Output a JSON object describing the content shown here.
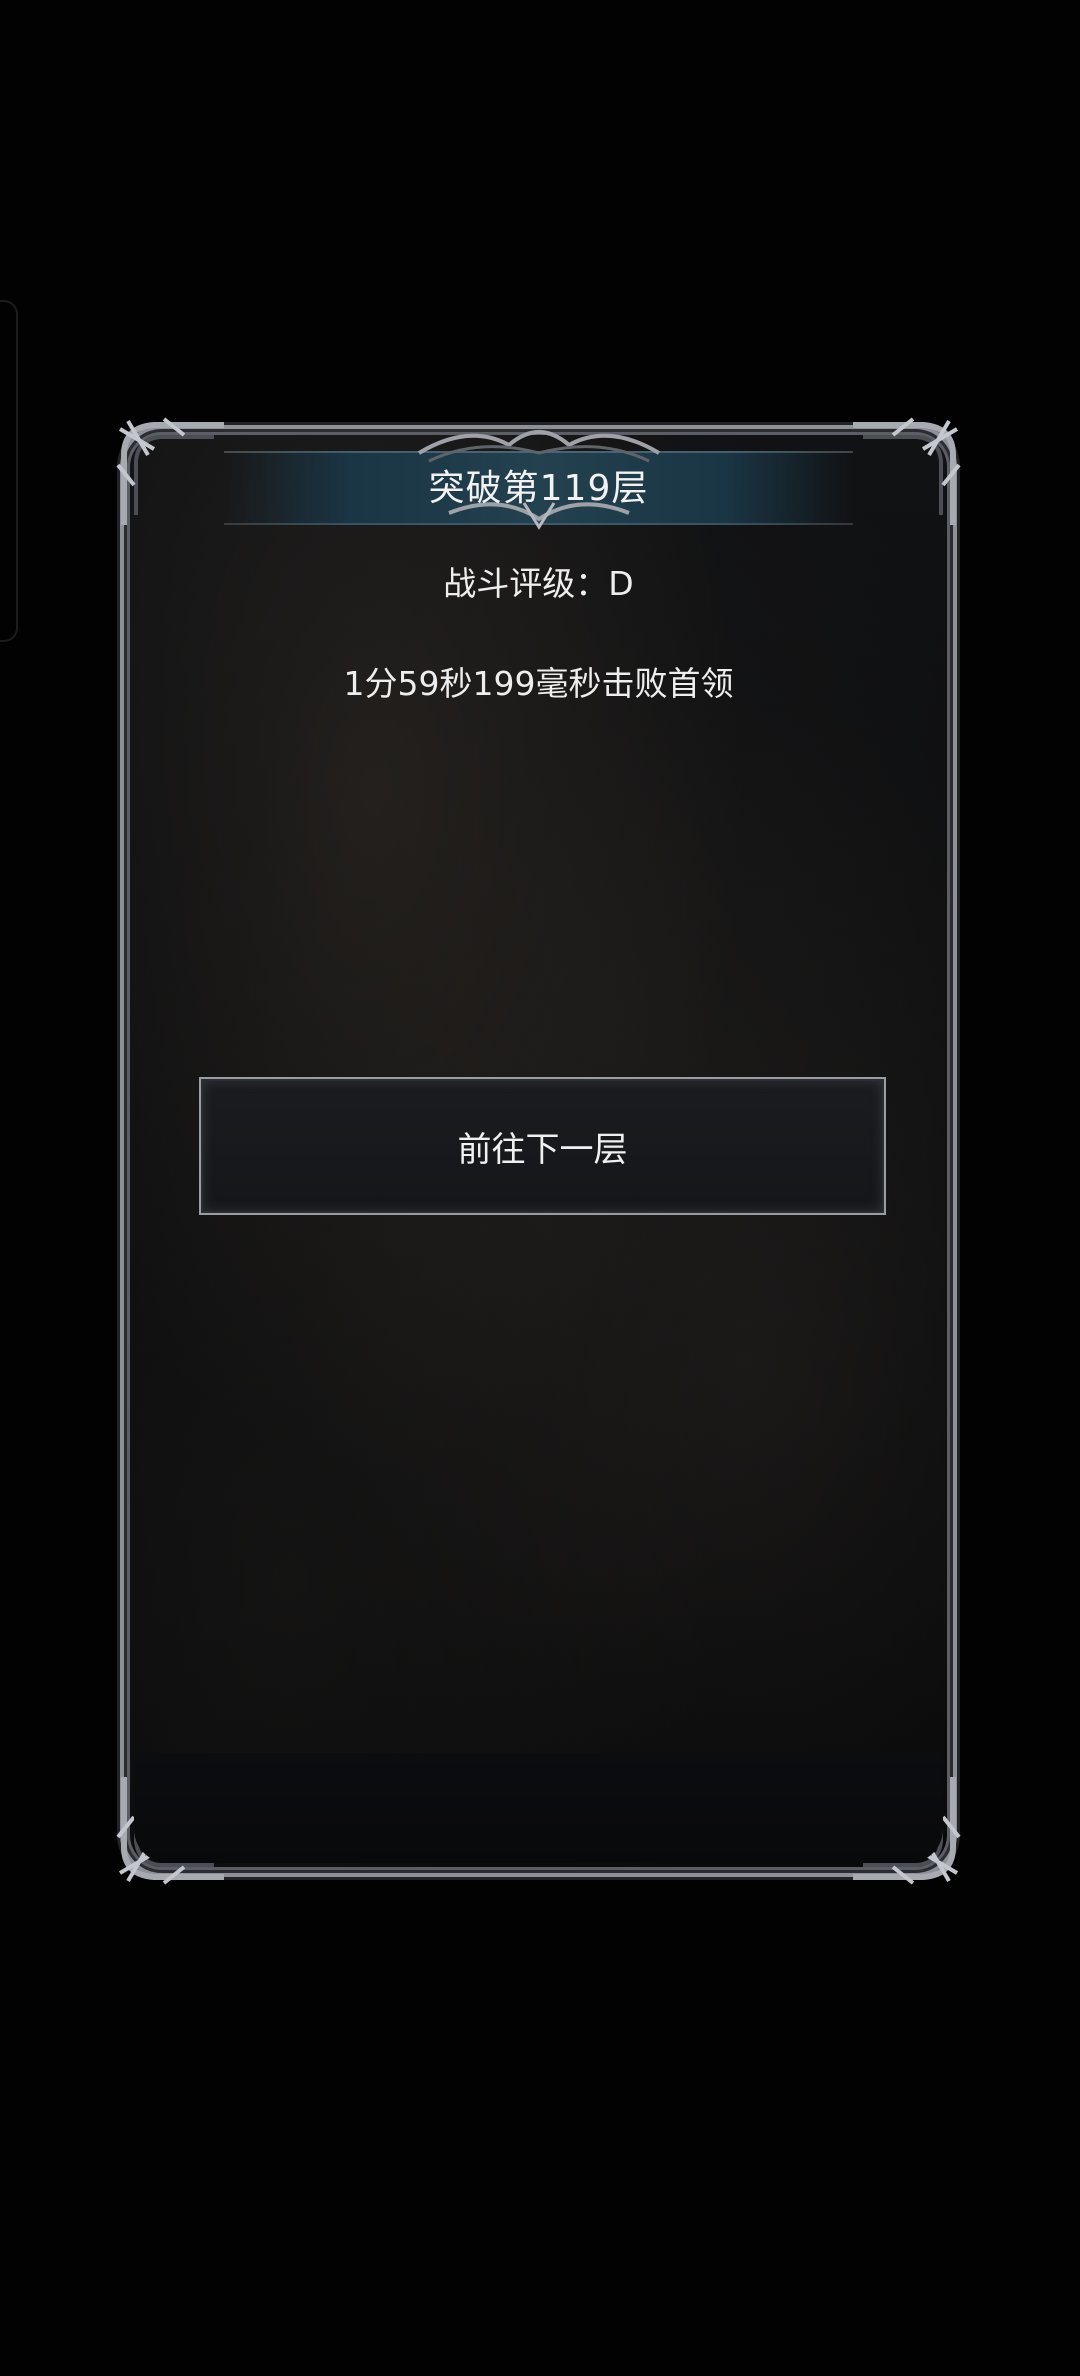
{
  "panel": {
    "title": "突破第119层",
    "rating": "战斗评级：D",
    "clear_time": "1分59秒199毫秒击败首领",
    "next_button_label": "前往下一层"
  },
  "colors": {
    "background": "#000000",
    "panel_border": "#8e9197",
    "title_bar": "#23414f",
    "text": "#f2f2f2"
  },
  "icons": {
    "corner_ornament": "gothic-corner-ornament-icon",
    "title_crest": "title-crest-ornament-icon"
  }
}
